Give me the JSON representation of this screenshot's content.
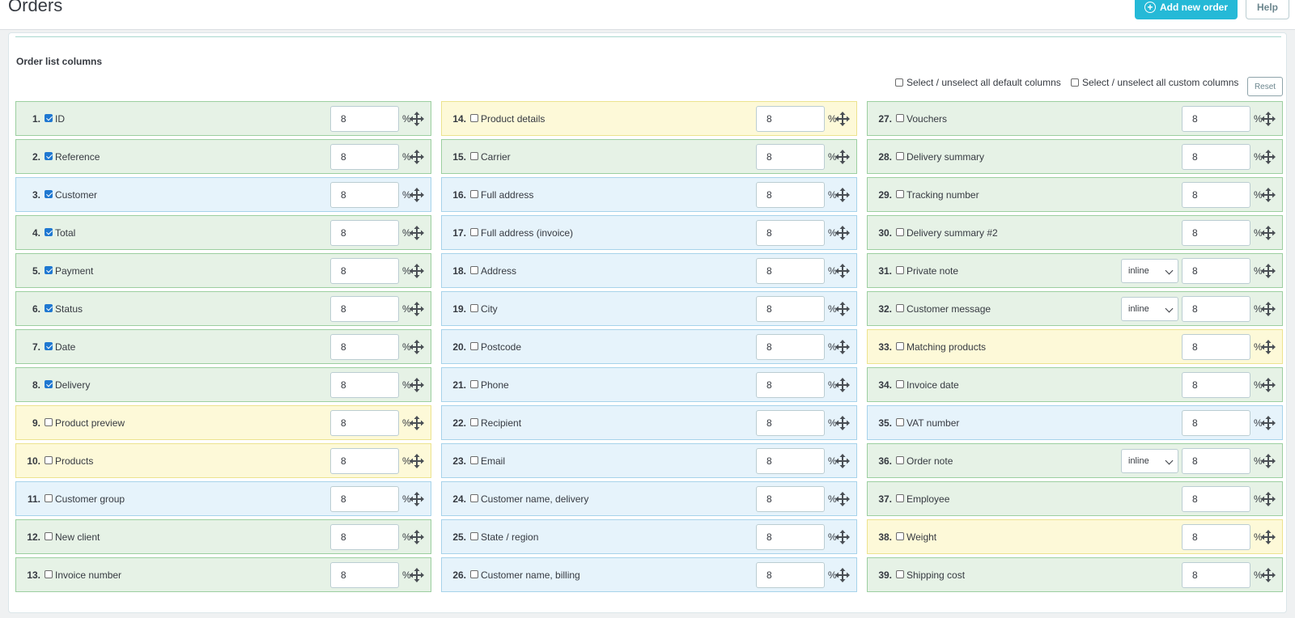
{
  "header": {
    "title": "Orders",
    "add_label": "Add new order",
    "help_label": "Help"
  },
  "panel": {
    "section_title": "Order list columns",
    "select_all_default": "Select / unselect all default columns",
    "select_all_custom": "Select / unselect all custom columns",
    "reset_label": "Reset"
  },
  "colors": {
    "green": "#e6f2e6",
    "blue": "#e6f3fb",
    "yellow": "#fdf9d8",
    "accent": "#25b9d7"
  },
  "icons": {
    "add": "plus-circle-icon",
    "drag": "move-arrows-icon"
  },
  "percent_sign": "%",
  "columns": [
    {
      "num": "1.",
      "label": "ID",
      "checked": true,
      "color": "green",
      "width": "8"
    },
    {
      "num": "2.",
      "label": "Reference",
      "checked": true,
      "color": "green",
      "width": "8"
    },
    {
      "num": "3.",
      "label": "Customer",
      "checked": true,
      "color": "blue",
      "width": "8"
    },
    {
      "num": "4.",
      "label": "Total",
      "checked": true,
      "color": "green",
      "width": "8"
    },
    {
      "num": "5.",
      "label": "Payment",
      "checked": true,
      "color": "green",
      "width": "8"
    },
    {
      "num": "6.",
      "label": "Status",
      "checked": true,
      "color": "green",
      "width": "8"
    },
    {
      "num": "7.",
      "label": "Date",
      "checked": true,
      "color": "green",
      "width": "8"
    },
    {
      "num": "8.",
      "label": "Delivery",
      "checked": true,
      "color": "green",
      "width": "8"
    },
    {
      "num": "9.",
      "label": "Product preview",
      "checked": false,
      "color": "yellow",
      "width": "8"
    },
    {
      "num": "10.",
      "label": "Products",
      "checked": false,
      "color": "yellow",
      "width": "8"
    },
    {
      "num": "11.",
      "label": "Customer group",
      "checked": false,
      "color": "blue",
      "width": "8"
    },
    {
      "num": "12.",
      "label": "New client",
      "checked": false,
      "color": "green",
      "width": "8"
    },
    {
      "num": "13.",
      "label": "Invoice number",
      "checked": false,
      "color": "green",
      "width": "8"
    },
    {
      "num": "14.",
      "label": "Product details",
      "checked": false,
      "color": "yellow",
      "width": "8"
    },
    {
      "num": "15.",
      "label": "Carrier",
      "checked": false,
      "color": "green",
      "width": "8"
    },
    {
      "num": "16.",
      "label": "Full address",
      "checked": false,
      "color": "blue",
      "width": "8"
    },
    {
      "num": "17.",
      "label": "Full address (invoice)",
      "checked": false,
      "color": "blue",
      "width": "8"
    },
    {
      "num": "18.",
      "label": "Address",
      "checked": false,
      "color": "blue",
      "width": "8"
    },
    {
      "num": "19.",
      "label": "City",
      "checked": false,
      "color": "blue",
      "width": "8"
    },
    {
      "num": "20.",
      "label": "Postcode",
      "checked": false,
      "color": "blue",
      "width": "8"
    },
    {
      "num": "21.",
      "label": "Phone",
      "checked": false,
      "color": "blue",
      "width": "8"
    },
    {
      "num": "22.",
      "label": "Recipient",
      "checked": false,
      "color": "blue",
      "width": "8"
    },
    {
      "num": "23.",
      "label": "Email",
      "checked": false,
      "color": "blue",
      "width": "8"
    },
    {
      "num": "24.",
      "label": "Customer name, delivery",
      "checked": false,
      "color": "blue",
      "width": "8"
    },
    {
      "num": "25.",
      "label": "State / region",
      "checked": false,
      "color": "blue",
      "width": "8"
    },
    {
      "num": "26.",
      "label": "Customer name, billing",
      "checked": false,
      "color": "blue",
      "width": "8"
    },
    {
      "num": "27.",
      "label": "Vouchers",
      "checked": false,
      "color": "green",
      "width": "8"
    },
    {
      "num": "28.",
      "label": "Delivery summary",
      "checked": false,
      "color": "green",
      "width": "8"
    },
    {
      "num": "29.",
      "label": "Tracking number",
      "checked": false,
      "color": "green",
      "width": "8"
    },
    {
      "num": "30.",
      "label": "Delivery summary #2",
      "checked": false,
      "color": "green",
      "width": "8"
    },
    {
      "num": "31.",
      "label": "Private note",
      "checked": false,
      "color": "green",
      "width": "8",
      "mode": "inline"
    },
    {
      "num": "32.",
      "label": "Customer message",
      "checked": false,
      "color": "green",
      "width": "8",
      "mode": "inline"
    },
    {
      "num": "33.",
      "label": "Matching products",
      "checked": false,
      "color": "yellow",
      "width": "8"
    },
    {
      "num": "34.",
      "label": "Invoice date",
      "checked": false,
      "color": "green",
      "width": "8"
    },
    {
      "num": "35.",
      "label": "VAT number",
      "checked": false,
      "color": "blue",
      "width": "8"
    },
    {
      "num": "36.",
      "label": "Order note",
      "checked": false,
      "color": "green",
      "width": "8",
      "mode": "inline"
    },
    {
      "num": "37.",
      "label": "Employee",
      "checked": false,
      "color": "green",
      "width": "8"
    },
    {
      "num": "38.",
      "label": "Weight",
      "checked": false,
      "color": "yellow",
      "width": "8"
    },
    {
      "num": "39.",
      "label": "Shipping cost",
      "checked": false,
      "color": "green",
      "width": "8"
    }
  ]
}
